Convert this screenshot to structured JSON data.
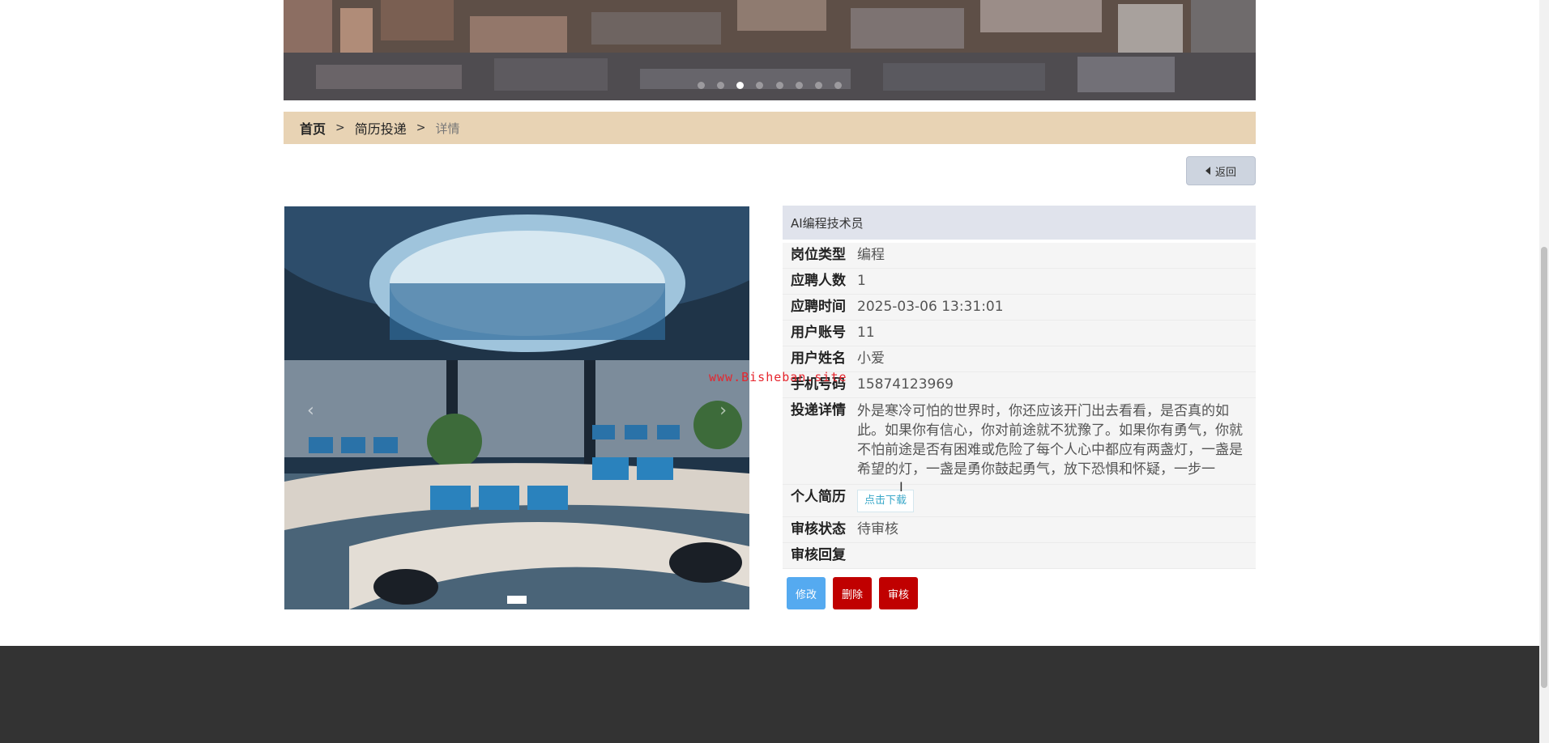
{
  "banner": {
    "slide_count": 8,
    "active_index": 2
  },
  "breadcrumb": {
    "home": "首页",
    "section": "简历投递",
    "current": "详情",
    "separator": ">"
  },
  "back_button": {
    "label": "返回"
  },
  "carousel": {
    "prev": "‹",
    "next": "›"
  },
  "detail": {
    "title": "AI编程技术员",
    "fields": [
      {
        "label": "岗位类型",
        "value": "编程"
      },
      {
        "label": "应聘人数",
        "value": "1"
      },
      {
        "label": "应聘时间",
        "value": "2025-03-06 13:31:01"
      },
      {
        "label": "用户账号",
        "value": "11"
      },
      {
        "label": "用户姓名",
        "value": "小爱"
      },
      {
        "label": "手机号码",
        "value": "15874123969"
      },
      {
        "label": "投递详情",
        "value": "外是寒冷可怕的世界时，你还应该开门出去看看，是否真的如此。如果你有信心，你对前途就不犹豫了。如果你有勇气，你就不怕前途是否有困难或危险了每个人心中都应有两盏灯，一盏是希望的灯，一盏是勇你鼓起勇气，放下恐惧和怀疑，一步一"
      },
      {
        "label": "个人简历",
        "value": "点击下载"
      },
      {
        "label": "审核状态",
        "value": "待审核"
      },
      {
        "label": "审核回复",
        "value": ""
      }
    ]
  },
  "actions": {
    "edit": "修改",
    "delete": "删除",
    "audit": "审核"
  },
  "watermark": "www.Bisheban.site",
  "colors": {
    "breadcrumb_bg": "#e8d3b4",
    "title_bar_bg": "#e0e3ec",
    "edit_btn": "#55aaf0",
    "danger_btn": "#c00000",
    "footer_bg": "#333333"
  }
}
